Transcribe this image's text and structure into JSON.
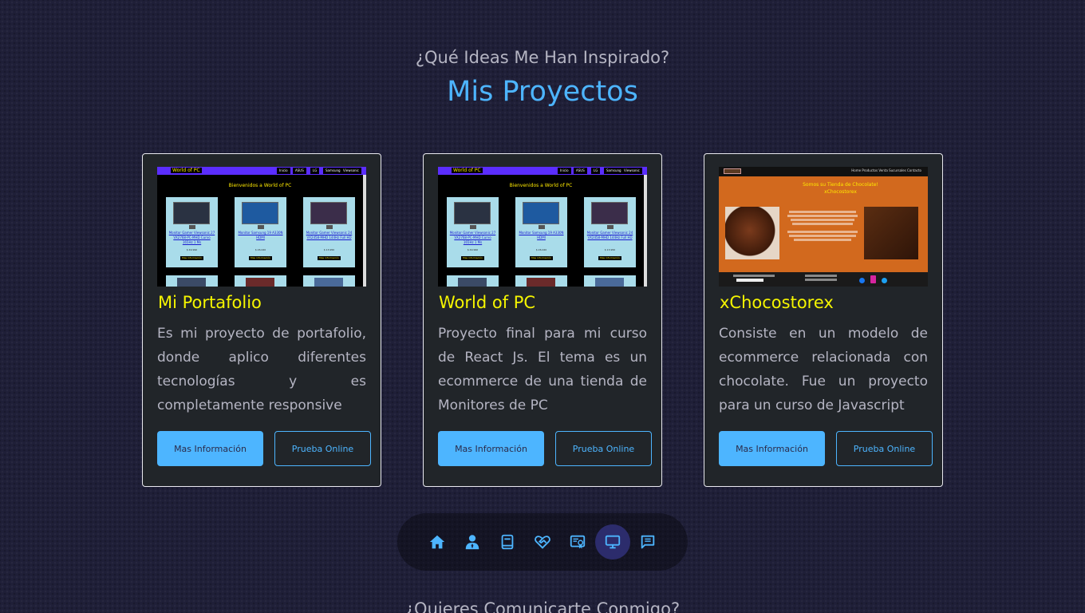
{
  "section": {
    "subtitle": "¿Qué Ideas Me Han Inspirado?",
    "title": "Mis Proyectos"
  },
  "projects": [
    {
      "title": "Mi Portafolio",
      "description": "Es mi proyecto de portafolio, donde aplico diferentes tecnologías y es completamente responsive",
      "more_label": "Mas Información",
      "demo_label": "Prueba Online"
    },
    {
      "title": "World of PC",
      "description": "Proyecto final para mi curso de React Js. El tema es un ecommerce de una tienda de Monitores de PC",
      "more_label": "Mas Información",
      "demo_label": "Prueba Online"
    },
    {
      "title": "xChocostorex",
      "description": "Consiste en un modelo de ecommerce relacionada con chocolate. Fue un proyecto para un curso de Javascript",
      "more_label": "Mas Información",
      "demo_label": "Prueba Online"
    }
  ],
  "preview_wpc": {
    "brand": "World of PC",
    "menu": [
      "Inicio",
      "ASUS",
      "LG",
      "Samsung",
      "Viewsonic"
    ],
    "heading": "Bienvenidos a World of PC",
    "products": [
      {
        "name": "Monitor Gamer Viewsonic 27 VX2768-PC-MHD Curvo 165Hz 1 Ms",
        "price": "$ 49.990",
        "button": "Mas información"
      },
      {
        "name": "Monitor Samsung 19 A330N HDMI",
        "price": "$ 26.020",
        "button": "Mas información"
      },
      {
        "name": "Monitor Gamer Viewsonic 24 VX2458-MHD 144Hz Full HD",
        "price": "$ 13.950",
        "button": "Mas información"
      }
    ]
  },
  "preview_choco": {
    "links": "Home  Productos  Venta  Sucursales  Contacto",
    "heading_1": "Somos su Tienda de Chocolate!",
    "heading_2": "xChocostorex"
  },
  "nav": {
    "items": [
      "home-icon",
      "user-icon",
      "book-icon",
      "heart-handshake-icon",
      "certificate-icon",
      "monitor-icon",
      "message-icon"
    ],
    "active_index": 5,
    "accent": "#4db5ff"
  },
  "next_section": {
    "title": "¿Quieres Comunicarte Conmigo?"
  }
}
